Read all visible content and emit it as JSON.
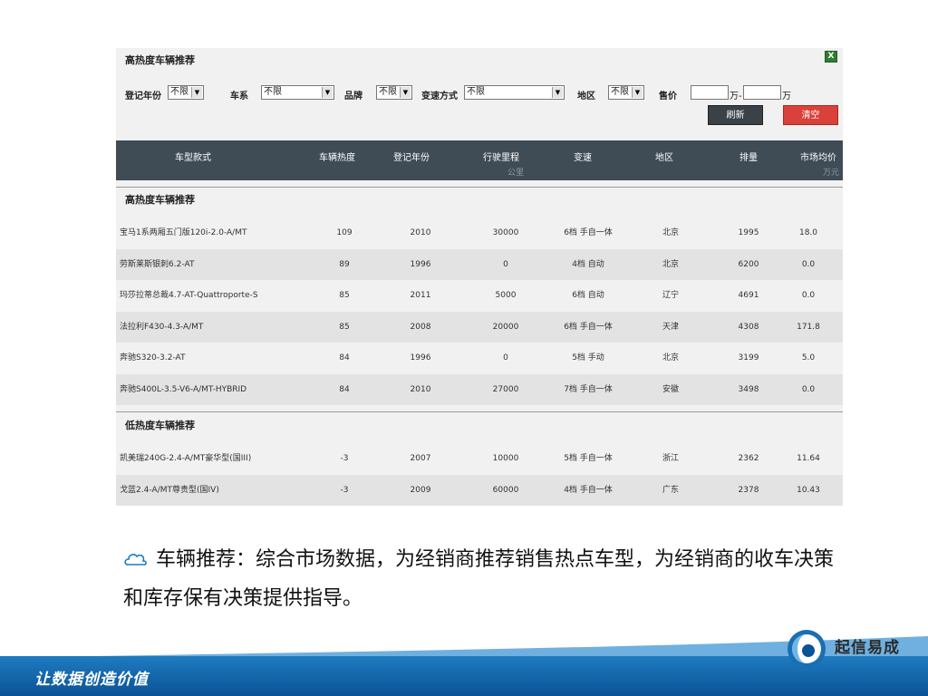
{
  "panel": {
    "title": "高热度车辆推荐",
    "export_icon": "excel-icon",
    "filters": {
      "year_label": "登记年份",
      "year_value": "不限",
      "series_label": "车系",
      "series_value": "不限",
      "brand_label": "品牌",
      "brand_value": "不限",
      "trans_label": "变速方式",
      "trans_value": "不限",
      "region_label": "地区",
      "region_value": "不限",
      "price_label": "售价",
      "price_min": "",
      "price_max": "",
      "unit1": "万-",
      "unit2": "万",
      "refresh_label": "刷新",
      "clear_label": "清空"
    },
    "columns": {
      "model": "车型款式",
      "heat": "车辆热度",
      "year": "登记年份",
      "km": "行驶里程",
      "km_unit": "公里",
      "trans": "变速",
      "region": "地区",
      "disp": "排量",
      "price": "市场均价",
      "price_unit": "万元"
    },
    "high_group_title": "高热度车辆推荐",
    "low_group_title": "低热度车辆推荐",
    "high_rows": [
      {
        "model": "宝马1系两厢五门版120i-2.0-A/MT",
        "heat": "109",
        "year": "2010",
        "km": "30000",
        "trans": "6档 手自一体",
        "region": "北京",
        "disp": "1995",
        "price": "18.0"
      },
      {
        "model": "劳斯莱斯银刺6.2-AT",
        "heat": "89",
        "year": "1996",
        "km": "0",
        "trans": "4档 自动",
        "region": "北京",
        "disp": "6200",
        "price": "0.0"
      },
      {
        "model": "玛莎拉蒂总裁4.7-AT-Quattroporte-S",
        "heat": "85",
        "year": "2011",
        "km": "5000",
        "trans": "6档 自动",
        "region": "辽宁",
        "disp": "4691",
        "price": "0.0"
      },
      {
        "model": "法拉利F430-4.3-A/MT",
        "heat": "85",
        "year": "2008",
        "km": "20000",
        "trans": "6档 手自一体",
        "region": "天津",
        "disp": "4308",
        "price": "171.8"
      },
      {
        "model": "奔驰S320-3.2-AT",
        "heat": "84",
        "year": "1996",
        "km": "0",
        "trans": "5档 手动",
        "region": "北京",
        "disp": "3199",
        "price": "5.0"
      },
      {
        "model": "奔驰S400L-3.5-V6-A/MT-HYBRID",
        "heat": "84",
        "year": "2010",
        "km": "27000",
        "trans": "7档 手自一体",
        "region": "安徽",
        "disp": "3498",
        "price": "0.0"
      }
    ],
    "low_rows": [
      {
        "model": "凯美瑞240G-2.4-A/MT豪华型(国III)",
        "heat": "-3",
        "year": "2007",
        "km": "10000",
        "trans": "5档 手自一体",
        "region": "浙江",
        "disp": "2362",
        "price": "11.64"
      },
      {
        "model": "戈蓝2.4-A/MT尊贵型(国IV)",
        "heat": "-3",
        "year": "2009",
        "km": "60000",
        "trans": "4档 手自一体",
        "region": "广东",
        "disp": "2378",
        "price": "10.43"
      }
    ]
  },
  "caption": {
    "bullet_icon": "cloud-outline-icon",
    "text": "车辆推荐：综合市场数据，为经销商推荐销售热点车型，为经销商的收车决策和库存保有决策提供指导。"
  },
  "footer": {
    "slogan": "让数据创造价值",
    "company": "起信易成",
    "logo_icon": "company-logo-icon",
    "colors": {
      "bar": "#0a5396",
      "accent": "#1f7bc0"
    }
  }
}
